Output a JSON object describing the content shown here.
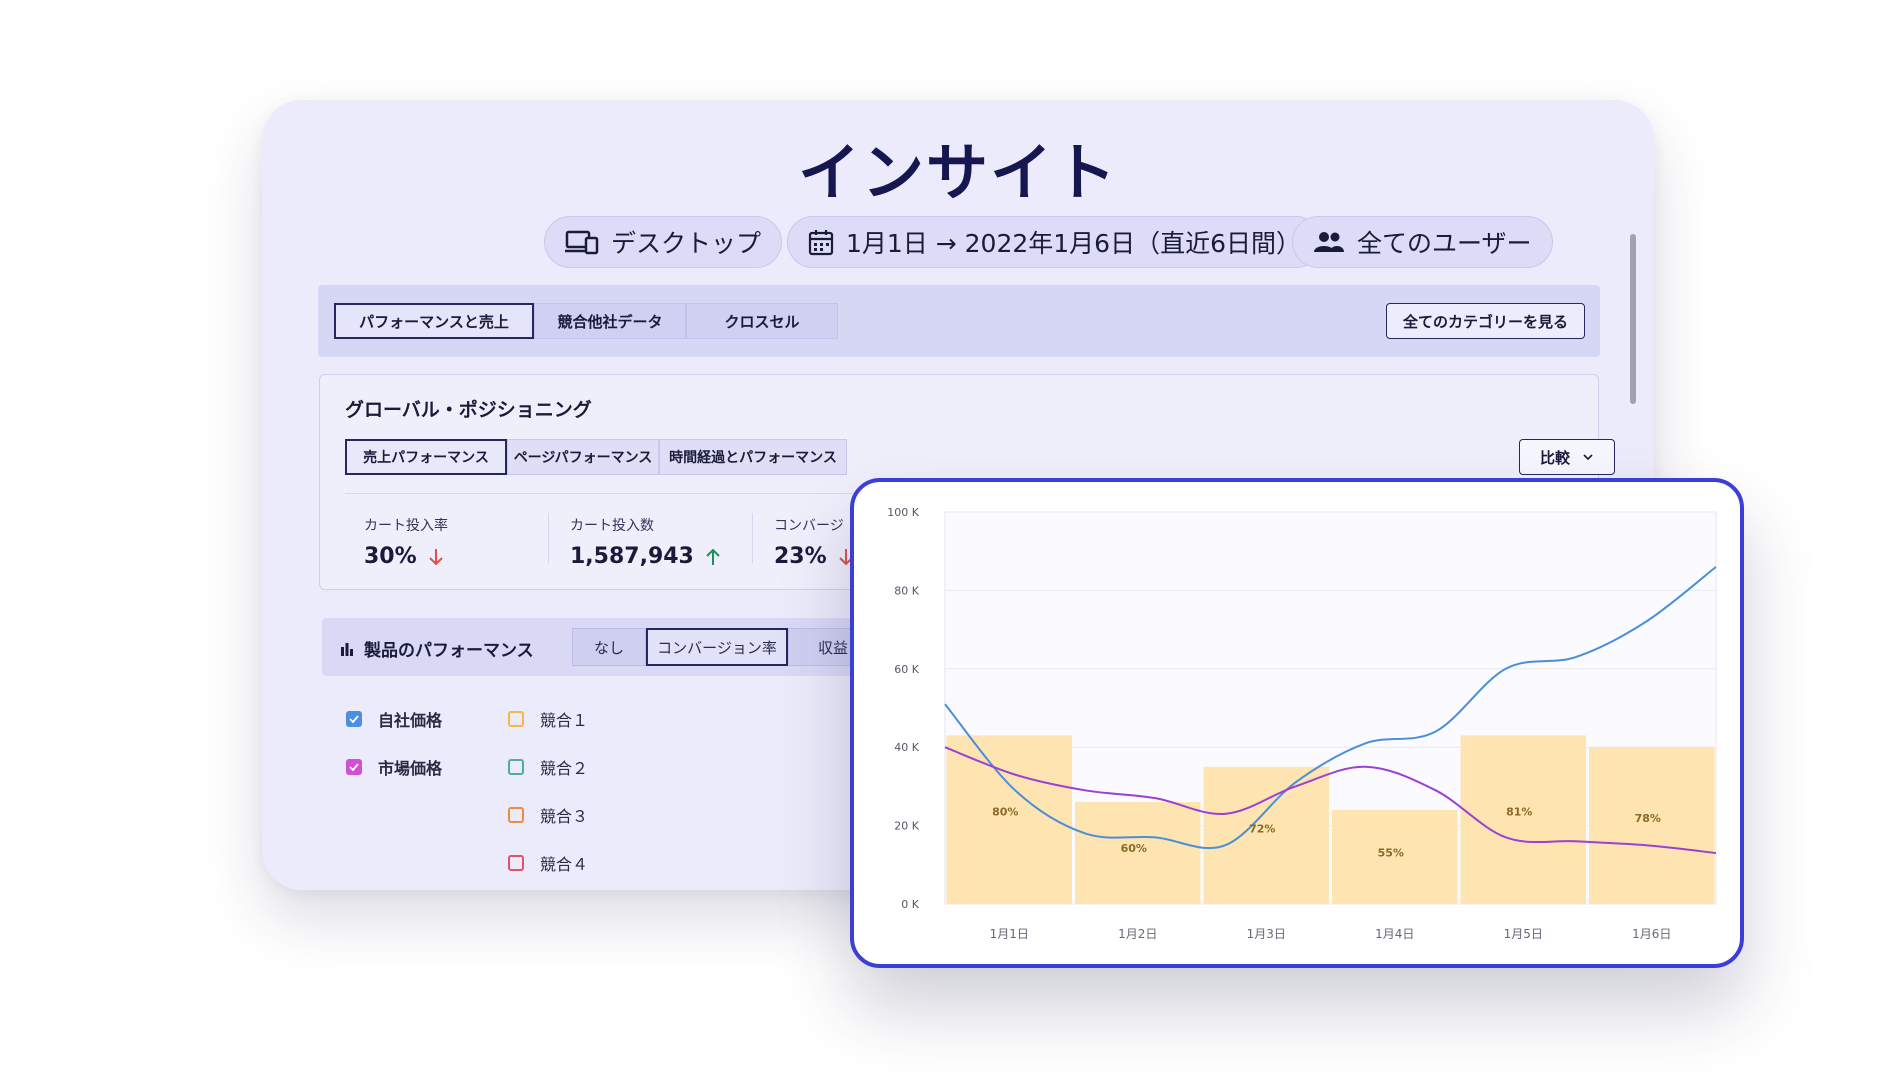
{
  "title": "インサイト",
  "filters": {
    "device": "デスクトップ",
    "date_range": "1月1日 → 2022年1月6日（直近6日間）",
    "users": "全てのユーザー"
  },
  "tabs": [
    "パフォーマンスと売上",
    "競合他社データ",
    "クロスセル"
  ],
  "active_tab": "パフォーマンスと売上",
  "category_button": "全てのカテゴリーを見る",
  "global_positioning": {
    "title": "グローバル・ポジショニング",
    "subtabs": [
      "売上パフォーマンス",
      "ページパフォーマンス",
      "時間経過とパフォーマンス"
    ],
    "compare_label": "比較",
    "metrics": [
      {
        "label": "カート投入率",
        "value": "30%",
        "trend": "down"
      },
      {
        "label": "カート投入数",
        "value": "1,587,943",
        "trend": "up"
      },
      {
        "label": "コンバージ",
        "value": "23%",
        "trend": "down"
      }
    ]
  },
  "product_performance": {
    "title": "製品のパフォーマンス",
    "options": [
      "なし",
      "コンバージョン率",
      "収益"
    ],
    "active_option": "コンバージョン率"
  },
  "legend": {
    "own": [
      {
        "label": "自社価格",
        "checked": true,
        "color": "#4a90e2"
      },
      {
        "label": "市場価格",
        "checked": true,
        "color": "#d14fd6"
      }
    ],
    "competitors": [
      {
        "label": "競合１",
        "color": "#f5b942"
      },
      {
        "label": "競合２",
        "color": "#4caf9a"
      },
      {
        "label": "競合３",
        "color": "#f08a3c"
      },
      {
        "label": "競合４",
        "color": "#e05265"
      }
    ]
  },
  "colors": {
    "accent": "#3b3fd6",
    "trend_up": "#1e8f5a",
    "trend_down": "#e0504a",
    "bar": "#fde4b0",
    "line_own": "#4a8fd8",
    "line_market": "#9c3fd4"
  },
  "chart_data": {
    "type": "bar",
    "categories": [
      "1月1日",
      "1月2日",
      "1月3日",
      "1月4日",
      "1月5日",
      "1月6日"
    ],
    "y_ticks": [
      "0 K",
      "20 K",
      "40 K",
      "60 K",
      "80 K",
      "100 K"
    ],
    "ylim": [
      0,
      100
    ],
    "bar_values": [
      43,
      26,
      35,
      24,
      43,
      40
    ],
    "bar_labels": [
      "80%",
      "60%",
      "72%",
      "55%",
      "81%",
      "78%"
    ],
    "series": [
      {
        "color": "#4a8fd8",
        "x": [
          0.0,
          0.5,
          1.0,
          1.5,
          2.0,
          2.5,
          3.0,
          3.5,
          4.0,
          4.5,
          5.0,
          5.5
        ],
        "values": [
          51,
          29,
          18,
          17,
          15,
          31,
          41,
          44,
          60,
          63,
          72,
          86
        ]
      },
      {
        "color": "#9c3fd4",
        "x": [
          0.0,
          0.5,
          1.0,
          1.5,
          2.0,
          2.5,
          3.0,
          3.5,
          4.0,
          4.5,
          5.0,
          5.5
        ],
        "values": [
          40,
          33,
          29,
          27,
          23,
          30,
          35,
          29,
          17,
          16,
          15,
          13
        ]
      }
    ],
    "grid": true
  }
}
